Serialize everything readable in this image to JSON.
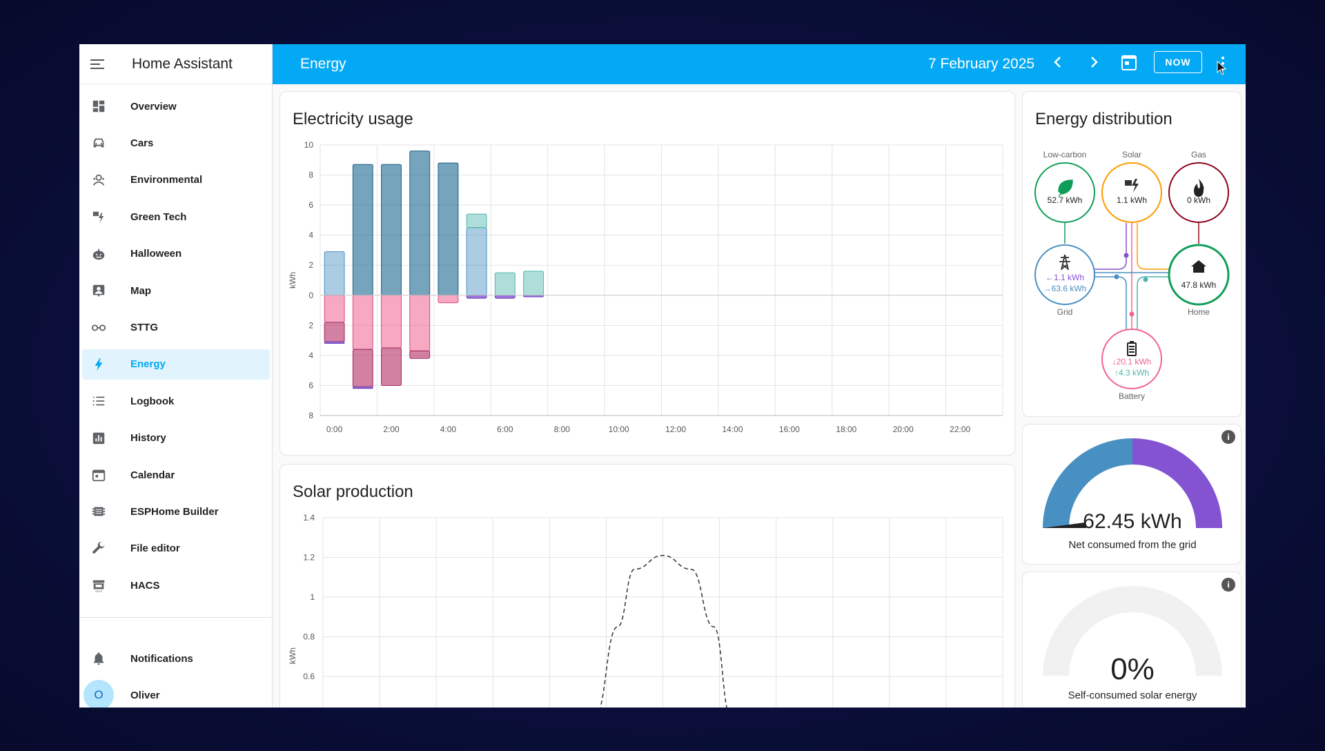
{
  "sidebar": {
    "title": "Home Assistant",
    "items": [
      {
        "label": "Overview",
        "icon": "dashboard-icon"
      },
      {
        "label": "Cars",
        "icon": "car-icon"
      },
      {
        "label": "Environmental",
        "icon": "environment-icon"
      },
      {
        "label": "Green Tech",
        "icon": "solar-power-icon"
      },
      {
        "label": "Halloween",
        "icon": "pumpkin-icon"
      },
      {
        "label": "Map",
        "icon": "map-icon"
      },
      {
        "label": "STTG",
        "icon": "glasses-icon"
      },
      {
        "label": "Energy",
        "icon": "lightning-icon",
        "active": true
      },
      {
        "label": "Logbook",
        "icon": "list-icon"
      },
      {
        "label": "History",
        "icon": "chart-box-icon"
      },
      {
        "label": "Calendar",
        "icon": "calendar-icon"
      },
      {
        "label": "ESPHome Builder",
        "icon": "chip-icon"
      },
      {
        "label": "File editor",
        "icon": "wrench-icon"
      },
      {
        "label": "HACS",
        "icon": "store-icon"
      }
    ],
    "notifications": "Notifications",
    "user": {
      "name": "Oliver",
      "initial": "O"
    }
  },
  "topbar": {
    "title": "Energy",
    "date": "7 February 2025",
    "now_label": "NOW"
  },
  "electricity": {
    "title": "Electricity usage",
    "ylabel": "kWh"
  },
  "solar": {
    "title": "Solar production",
    "ylabel": "kWh"
  },
  "distribution": {
    "title": "Energy distribution",
    "low_carbon": {
      "label": "Low-carbon",
      "value": "52.7 kWh"
    },
    "solar": {
      "label": "Solar",
      "value": "1.1 kWh"
    },
    "gas": {
      "label": "Gas",
      "value": "0 kWh"
    },
    "grid": {
      "label": "Grid",
      "in": "←1.1 kWh",
      "out": "→63.6 kWh"
    },
    "home": {
      "label": "Home",
      "value": "47.8 kWh"
    },
    "battery": {
      "label": "Battery",
      "in": "↓20.1 kWh",
      "out": "↑4.3 kWh"
    }
  },
  "gauge_grid": {
    "value": "62.45 kWh",
    "label": "Net consumed from the grid",
    "fraction_purple": 0.5
  },
  "gauge_solar": {
    "value": "0%",
    "label": "Self-consumed solar energy"
  },
  "colors": {
    "accent": "#03a9f4",
    "grid_in": "#488fc2",
    "grid_out": "#8353d1",
    "solar": "#ff9800",
    "battery_in": "#f06292",
    "battery_out": "#4db6ac",
    "low_carbon": "#0f9d58",
    "gas": "#8e021b"
  },
  "chart_data": [
    {
      "type": "bar",
      "title": "Electricity usage",
      "ylabel": "kWh",
      "ylim": [
        -8,
        10
      ],
      "yticks": [
        "10",
        "8",
        "6",
        "4",
        "2",
        "0",
        "2",
        "4",
        "6",
        "8"
      ],
      "xticks": [
        "0:00",
        "2:00",
        "4:00",
        "6:00",
        "8:00",
        "10:00",
        "12:00",
        "14:00",
        "16:00",
        "18:00",
        "20:00",
        "22:00"
      ],
      "categories": [
        "0:00",
        "1:00",
        "2:00",
        "3:00",
        "4:00",
        "5:00",
        "6:00",
        "7:00"
      ],
      "series": [
        {
          "values": [
            2.9,
            0,
            0,
            0,
            0,
            4.5,
            0,
            0
          ]
        },
        {
          "values": [
            0,
            8.7,
            8.7,
            9.6,
            8.8,
            0,
            0,
            0
          ]
        },
        {
          "values": [
            0,
            0,
            0,
            0,
            0,
            0.9,
            1.5,
            1.6
          ]
        },
        {
          "values": [
            -1.8,
            -3.6,
            -3.5,
            -3.7,
            -0.5,
            0,
            0,
            0
          ]
        },
        {
          "values": [
            -1.3,
            -2.5,
            -2.5,
            -0.5,
            0,
            0,
            0,
            0
          ]
        },
        {
          "values": [
            -0.1,
            -0.1,
            0,
            0,
            0,
            -0.2,
            -0.2,
            -0.1
          ]
        }
      ]
    },
    {
      "type": "line",
      "title": "Solar production",
      "ylabel": "kWh",
      "yticks": [
        "1.4",
        "1.2",
        "1",
        "0.8",
        "0.6"
      ],
      "ylim": [
        0.4,
        1.4
      ],
      "x": [
        9.6,
        10.4,
        11,
        12,
        13,
        13.8,
        14.4
      ],
      "y": [
        0.4,
        0.85,
        1.14,
        1.21,
        1.14,
        0.85,
        0.4
      ]
    }
  ]
}
